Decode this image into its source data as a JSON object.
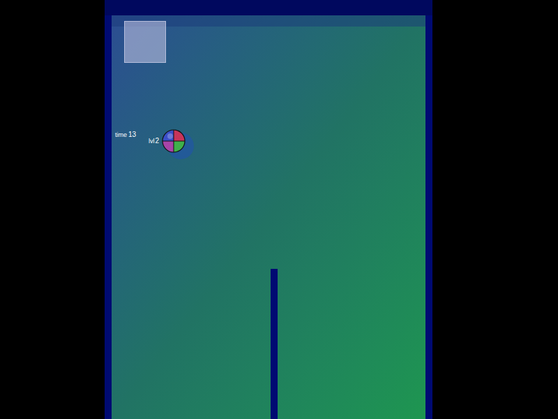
{
  "hud": {
    "time_label": "time",
    "time": "13",
    "level_label": "lvl",
    "level": "2"
  },
  "ball": {
    "quadrants": [
      {
        "name": "top-left",
        "color": "#3a4fc8"
      },
      {
        "name": "top-right",
        "color": "#c8345a"
      },
      {
        "name": "bottom-right",
        "color": "#3fb04a"
      },
      {
        "name": "bottom-left",
        "color": "#a844a8"
      }
    ]
  }
}
